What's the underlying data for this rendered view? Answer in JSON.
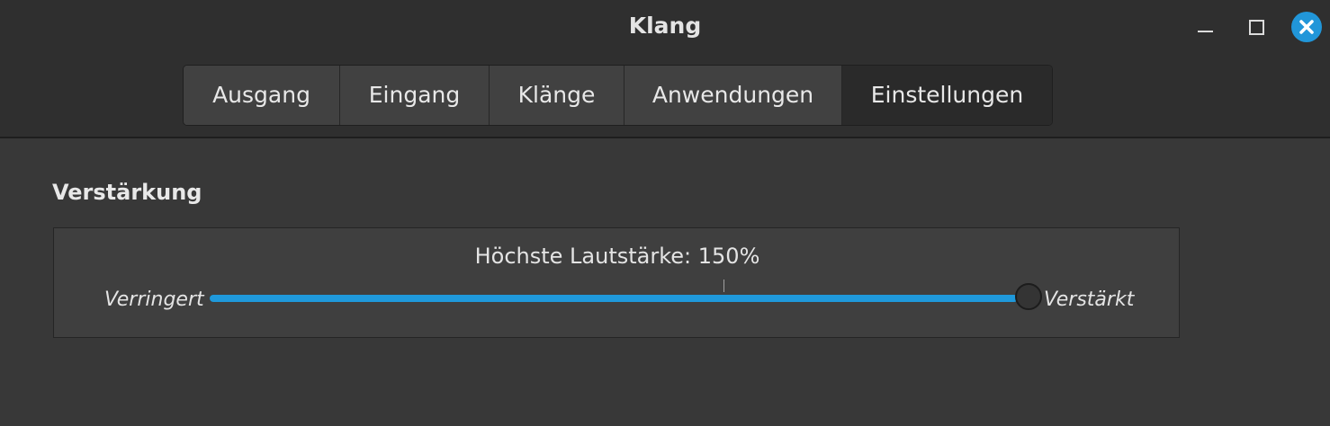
{
  "window": {
    "title": "Klang",
    "controls": {
      "minimize": "minimize-icon",
      "maximize": "maximize-icon",
      "close": "close-icon"
    },
    "accent_color": "#1f99db"
  },
  "tabs": [
    {
      "label": "Ausgang",
      "active": false
    },
    {
      "label": "Eingang",
      "active": false
    },
    {
      "label": "Klänge",
      "active": false
    },
    {
      "label": "Anwendungen",
      "active": false
    },
    {
      "label": "Einstellungen",
      "active": true
    }
  ],
  "amplification": {
    "section_title": "Verstärkung",
    "label_prefix": "Höchste Lautstärke: ",
    "value_text": "150%",
    "min_label": "Verringert",
    "max_label": "Verstärkt",
    "slider": {
      "value_percent": 150,
      "min_percent": 0,
      "max_percent": 150,
      "mark_percent": 100
    }
  }
}
